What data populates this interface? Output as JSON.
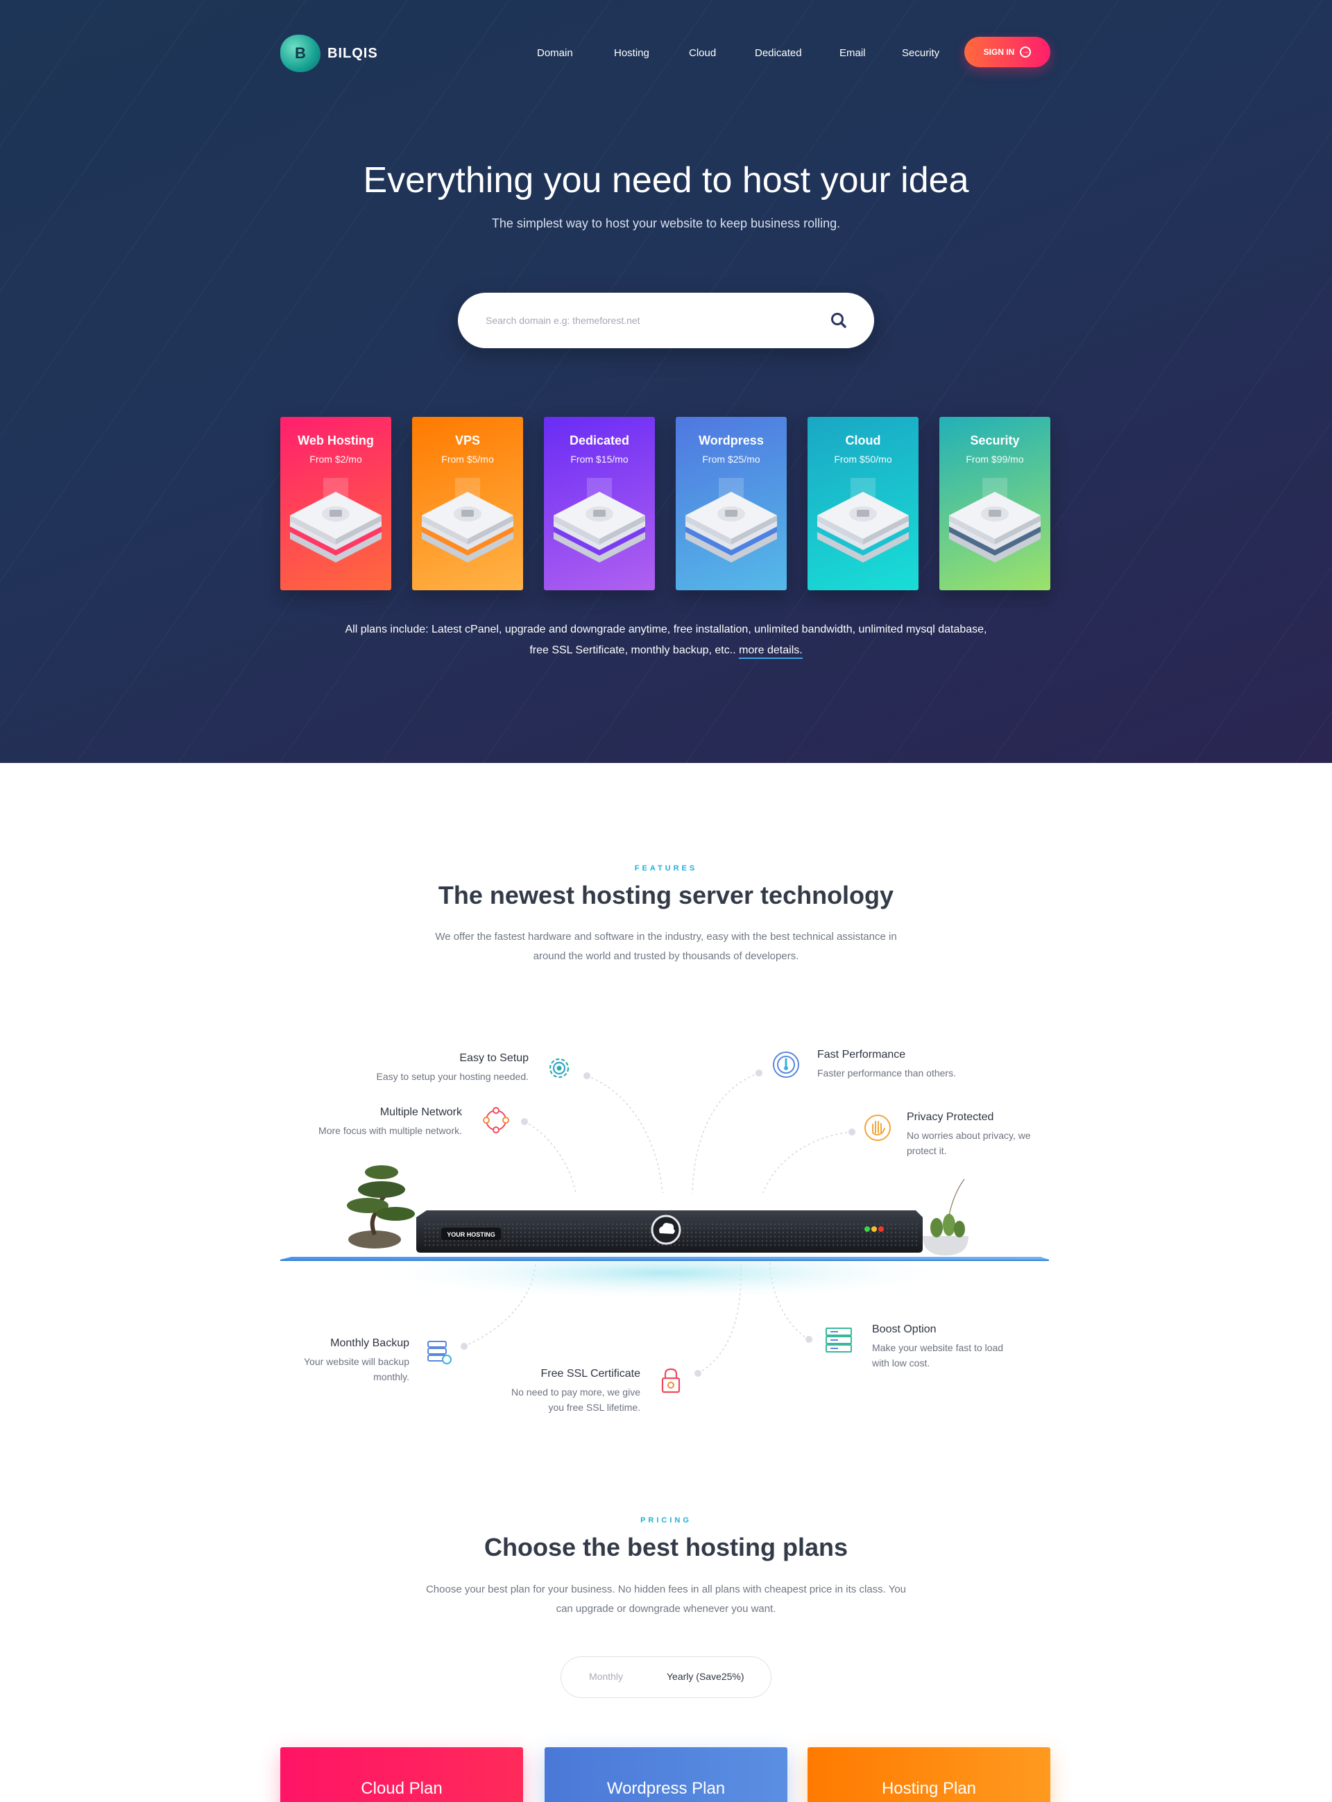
{
  "brand": {
    "name": "BILQIS",
    "letter": "B"
  },
  "nav": {
    "links": [
      "Domain",
      "Hosting",
      "Cloud",
      "Dedicated",
      "Email",
      "Security"
    ],
    "signin_label": "SIGN IN"
  },
  "hero": {
    "title": "Everything you need to host your idea",
    "subtitle": "The simplest way to host your website to keep business rolling.",
    "search_placeholder": "Search domain e.g: themeforest.net"
  },
  "products": [
    {
      "name": "Web Hosting",
      "price": "From $2/mo",
      "colors": [
        "#ff1f6e",
        "#ff6a3d"
      ],
      "accent": "#ff3866"
    },
    {
      "name": "VPS",
      "price": "From $5/mo",
      "colors": [
        "#ff7a00",
        "#ffb347"
      ],
      "accent": "#ff8a1f"
    },
    {
      "name": "Dedicated",
      "price": "From $15/mo",
      "colors": [
        "#6a2cf5",
        "#b061f0"
      ],
      "accent": "#7b3cf2"
    },
    {
      "name": "Wordpress",
      "price": "From $25/mo",
      "colors": [
        "#4f77e0",
        "#55b9e8"
      ],
      "accent": "#4d82e2"
    },
    {
      "name": "Cloud",
      "price": "From $50/mo",
      "colors": [
        "#1aa7c4",
        "#19ded7"
      ],
      "accent": "#1bc3d0"
    },
    {
      "name": "Security",
      "price": "From $99/mo",
      "colors": [
        "#22b0b8",
        "#9de26a"
      ],
      "accent": "#4f6b8a"
    }
  ],
  "plans_note": {
    "line1": "All plans include: Latest cPanel, upgrade and downgrade anytime, free installation, unlimited bandwidth, unlimited mysql database,",
    "line2": "free SSL Sertificate, monthly backup, etc..",
    "link": "more details."
  },
  "features": {
    "eyebrow": "FEATURES",
    "title": "The newest hosting server technology",
    "desc_line1": "We offer the fastest hardware and software in the industry, easy with the best technical assistance in",
    "desc_line2": "around the world and trusted by thousands of developers.",
    "server_label": "YOUR HOSTING",
    "items": {
      "easy_setup": {
        "title": "Easy to Setup",
        "desc": "Easy to setup your hosting needed."
      },
      "multiple_network": {
        "title": "Multiple Network",
        "desc": "More focus with multiple network."
      },
      "fast_performance": {
        "title": "Fast Performance",
        "desc": "Faster performance than others."
      },
      "privacy": {
        "title": "Privacy Protected",
        "desc1": "No worries about privacy, we",
        "desc2": "protect it."
      },
      "backup": {
        "title": "Monthly Backup",
        "desc1": "Your website will backup",
        "desc2": "monthly."
      },
      "ssl": {
        "title": "Free SSL Certificate",
        "desc1": "No need to pay more, we give",
        "desc2": "you free SSL lifetime."
      },
      "boost": {
        "title": "Boost Option",
        "desc1": "Make your website fast to load",
        "desc2": "with low cost."
      }
    }
  },
  "pricing": {
    "eyebrow": "PRICING",
    "title": "Choose the best hosting plans",
    "desc_line1": "Choose your best plan for your business. No hidden fees in all plans with cheapest price in its class. You",
    "desc_line2": "can upgrade or downgrade whenever you want.",
    "toggle": {
      "monthly": "Monthly",
      "yearly": "Yearly (Save25%)"
    },
    "plans": [
      "Cloud Plan",
      "Wordpress Plan",
      "Hosting Plan"
    ]
  },
  "colors": {
    "accent": "#1fb0d6",
    "signin": "#ff2a68",
    "hero_bg": "#1f3456"
  }
}
